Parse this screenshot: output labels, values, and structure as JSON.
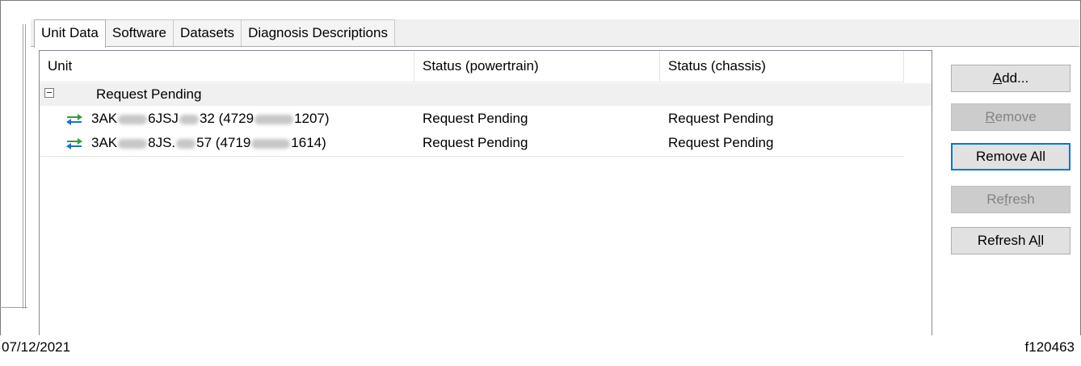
{
  "tabs": [
    {
      "label": "Unit Data",
      "active": true
    },
    {
      "label": "Software"
    },
    {
      "label": "Datasets"
    },
    {
      "label": "Diagnosis Descriptions"
    }
  ],
  "columns": [
    "Unit",
    "Status (powertrain)",
    "Status (chassis)"
  ],
  "group": {
    "label": "Request Pending",
    "expanded": true
  },
  "rows": [
    {
      "unit_a": "3AK",
      "unit_b": "6JSJ",
      "unit_c": "32 (4729",
      "unit_d": "1207)",
      "powertrain": "Request Pending",
      "chassis": "Request Pending"
    },
    {
      "unit_a": "3AK",
      "unit_b": "8JS.",
      "unit_c": "57 (4719",
      "unit_d": "1614)",
      "powertrain": "Request Pending",
      "chassis": "Request Pending"
    }
  ],
  "buttons": {
    "add": {
      "pre": "",
      "accel": "A",
      "post": "dd..."
    },
    "remove": {
      "pre": "",
      "accel": "R",
      "post": "emove"
    },
    "remove_all": {
      "label": "Remove All"
    },
    "refresh": {
      "pre": "Re",
      "accel": "f",
      "post": "resh"
    },
    "refresh_all": {
      "pre": "Refresh A",
      "accel": "l",
      "post": "l"
    }
  },
  "footer": {
    "date": "07/12/2021",
    "figure_id": "f120463"
  },
  "colors": {
    "default_button_border": "#0078d7",
    "group_row_bg": "#f0f0f0",
    "icon_green": "#2e9e3e",
    "icon_blue": "#1f6fd1"
  }
}
